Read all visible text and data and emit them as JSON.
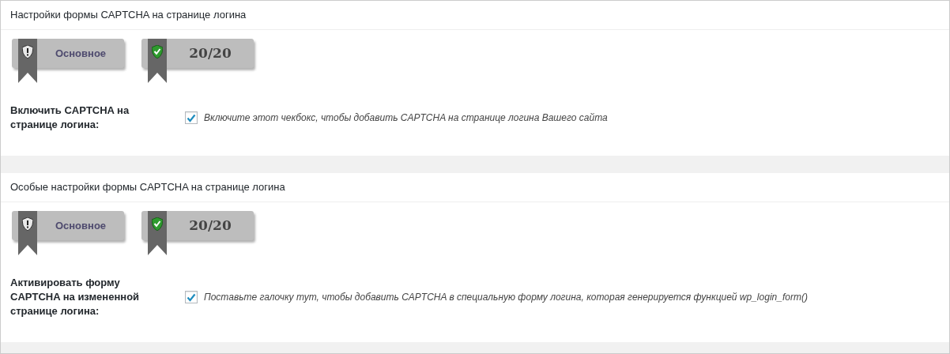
{
  "sections": [
    {
      "title": "Настройки формы CAPTCHA на странице логина",
      "badges": [
        {
          "kind": "warning",
          "text": "Основное"
        },
        {
          "kind": "ok",
          "text": "20/20"
        }
      ],
      "setting": {
        "label": "Включить CAPTCHA на странице логина:",
        "checked": true,
        "description": "Включите этот чекбокс, чтобы добавить CAPTCHA на странице логина Вашего сайта"
      }
    },
    {
      "title": "Особые настройки формы CAPTCHA на странице логина",
      "badges": [
        {
          "kind": "warning",
          "text": "Основное"
        },
        {
          "kind": "ok",
          "text": "20/20"
        }
      ],
      "setting": {
        "label": "Активировать форму CAPTCHA на измененной странице логина:",
        "checked": true,
        "description": "Поставьте галочку тут, чтобы добавить CAPTCHA в специальную форму логина, которая генерируется функцией wp_login_form()"
      }
    }
  ]
}
